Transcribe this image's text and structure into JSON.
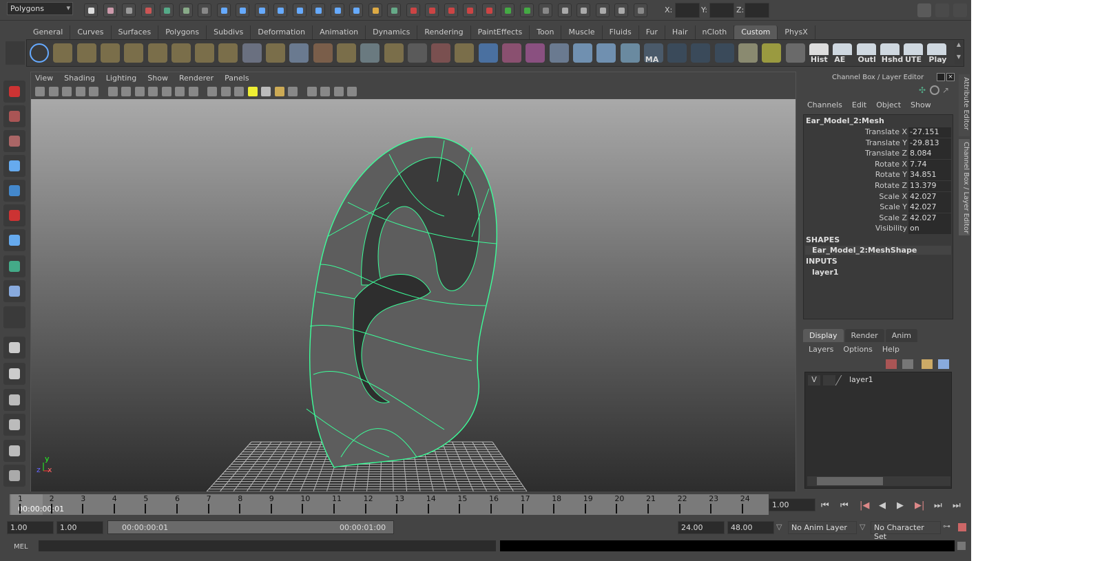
{
  "status_line": {
    "mode_menu": "Polygons",
    "x_label": "X:",
    "y_label": "Y:",
    "z_label": "Z:",
    "x_value": "",
    "y_value": "",
    "z_value": ""
  },
  "shelf_tabs": [
    "General",
    "Curves",
    "Surfaces",
    "Polygons",
    "Subdivs",
    "Deformation",
    "Animation",
    "Dynamics",
    "Rendering",
    "PaintEffects",
    "Toon",
    "Muscle",
    "Fluids",
    "Fur",
    "Hair",
    "nCloth",
    "Custom",
    "PhysX"
  ],
  "shelf_active": "Custom",
  "shelf_icons": [
    {
      "name": "nurbs-circle",
      "label": "",
      "color": "#3a3a3a"
    },
    {
      "name": "poly-sphere",
      "label": "",
      "color": "#7a6e4a"
    },
    {
      "name": "poly-cube",
      "label": "",
      "color": "#7a6e4a"
    },
    {
      "name": "poly-cylinder",
      "label": "",
      "color": "#7a6e4a"
    },
    {
      "name": "poly-plane",
      "label": "",
      "color": "#7a6e4a"
    },
    {
      "name": "poly-torus",
      "label": "",
      "color": "#7a6e4a"
    },
    {
      "name": "append-polygon",
      "label": "",
      "color": "#7a6e4a"
    },
    {
      "name": "extrude",
      "label": "",
      "color": "#7a6e4a"
    },
    {
      "name": "insert-edge-loop",
      "label": "",
      "color": "#7a6e4a"
    },
    {
      "name": "split-polygon",
      "label": "",
      "color": "#6a7080"
    },
    {
      "name": "merge-vertices",
      "label": "",
      "color": "#7a6e4a"
    },
    {
      "name": "bridge",
      "label": "",
      "color": "#6a7a90"
    },
    {
      "name": "cut-faces",
      "label": "",
      "color": "#7a5e4a"
    },
    {
      "name": "select-tool",
      "label": "",
      "color": "#7a6e4a"
    },
    {
      "name": "uv-editor",
      "label": "",
      "color": "#6a7a80"
    },
    {
      "name": "planar-map",
      "label": "",
      "color": "#7a6e4a"
    },
    {
      "name": "smooth",
      "label": "",
      "color": "#5a5a5a"
    },
    {
      "name": "transfer",
      "label": "",
      "color": "#7a5050"
    },
    {
      "name": "combine",
      "label": "",
      "color": "#7a6e4a"
    },
    {
      "name": "spheres",
      "label": "",
      "color": "#4a70a0"
    },
    {
      "name": "boolean-union",
      "label": "",
      "color": "#8a5070"
    },
    {
      "name": "boolean-diff",
      "label": "",
      "color": "#8a5080"
    },
    {
      "name": "goblet",
      "label": "",
      "color": "#6a7a90"
    },
    {
      "name": "revolve",
      "label": "",
      "color": "#7090b0"
    },
    {
      "name": "loft",
      "label": "",
      "color": "#7090b0"
    },
    {
      "name": "globe",
      "label": "",
      "color": "#6a8aa0"
    },
    {
      "name": "ma-script",
      "label": "MA",
      "color": "#4a5a6a"
    },
    {
      "name": "cv-curve",
      "label": "",
      "color": "#3a4a5a"
    },
    {
      "name": "ep-curve",
      "label": "",
      "color": "#3a4a5a"
    },
    {
      "name": "arc-curve",
      "label": "",
      "color": "#3a4a5a"
    },
    {
      "name": "spot-light",
      "label": "",
      "color": "#8a8a70"
    },
    {
      "name": "locator",
      "label": "",
      "color": "#9a9a40"
    },
    {
      "name": "camera",
      "label": "",
      "color": "#6a6a6a"
    },
    {
      "name": "history",
      "label": "Hist",
      "color": "#dddddd"
    },
    {
      "name": "attribute-editor",
      "label": "AE",
      "color": "#cfd8e0"
    },
    {
      "name": "outliner",
      "label": "Outl",
      "color": "#cfd8e0"
    },
    {
      "name": "hypershade",
      "label": "Hshd",
      "color": "#cfd8e0"
    },
    {
      "name": "uv-texture-editor",
      "label": "UTE",
      "color": "#cfd8e0"
    },
    {
      "name": "playblast",
      "label": "Play",
      "color": "#cfd8e0"
    }
  ],
  "viewport": {
    "menu": [
      "View",
      "Shading",
      "Lighting",
      "Show",
      "Renderer",
      "Panels"
    ],
    "axis_y": "y",
    "axis_x": "x",
    "axis_z": "z"
  },
  "channel_box": {
    "title": "Channel Box / Layer Editor",
    "menu": [
      "Channels",
      "Edit",
      "Object",
      "Show"
    ],
    "object": "Ear_Model_2:Mesh",
    "channels": [
      {
        "label": "Translate X",
        "value": "-27.151"
      },
      {
        "label": "Translate Y",
        "value": "-29.813"
      },
      {
        "label": "Translate Z",
        "value": "8.084"
      },
      {
        "label": "Rotate X",
        "value": "7.74"
      },
      {
        "label": "Rotate Y",
        "value": "34.851"
      },
      {
        "label": "Rotate Z",
        "value": "13.379"
      },
      {
        "label": "Scale X",
        "value": "42.027"
      },
      {
        "label": "Scale Y",
        "value": "42.027"
      },
      {
        "label": "Scale Z",
        "value": "42.027"
      },
      {
        "label": "Visibility",
        "value": "on"
      }
    ],
    "shapes_header": "SHAPES",
    "shape": "Ear_Model_2:MeshShape",
    "inputs_header": "INPUTS",
    "input": "layer1"
  },
  "layer_editor": {
    "tabs": [
      "Display",
      "Render",
      "Anim"
    ],
    "active": "Display",
    "menu": [
      "Layers",
      "Options",
      "Help"
    ],
    "layers": [
      {
        "visible": "V",
        "name": "layer1"
      }
    ]
  },
  "side_tabs": [
    "Attribute Editor",
    "Channel Box / Layer Editor"
  ],
  "timeline": {
    "start": 1,
    "end": 24,
    "current_time": "00:00:00:01",
    "current_frame": "1.00"
  },
  "range": {
    "start_time": "1.00",
    "playback_start": "1.00",
    "range_start": "00:00:00:01",
    "range_end": "00:00:01:00",
    "playback_end": "24.00",
    "end_time": "48.00",
    "anim_layer": "No Anim Layer",
    "character_set": "No Character Set"
  },
  "command_line": {
    "label": "MEL"
  }
}
